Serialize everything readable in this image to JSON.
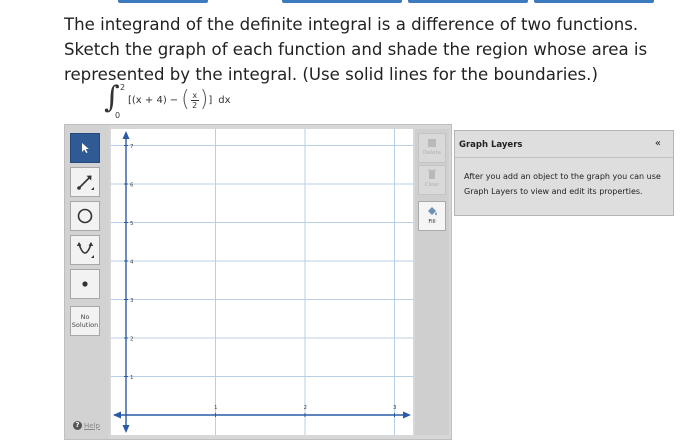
{
  "question": {
    "text": "The integrand of the definite integral is a difference of two functions. Sketch the graph of each function and shade the region whose area is represented by the integral. (Use solid lines for the boundaries.)"
  },
  "integral": {
    "upper": "2",
    "lower": "0",
    "bracket_open": "[",
    "term1": "(x + 4)",
    "minus": "−",
    "frac_num": "x",
    "frac_den": "2",
    "bracket_close": "]",
    "dx": "dx"
  },
  "toolbar": {
    "tools": [
      {
        "name": "select-tool",
        "icon": "arrow-pointer-icon",
        "active": true
      },
      {
        "name": "line-tool",
        "icon": "line-segment-icon",
        "active": false
      },
      {
        "name": "circle-tool",
        "icon": "circle-icon",
        "active": false
      },
      {
        "name": "parabola-tool",
        "icon": "parabola-icon",
        "active": false
      },
      {
        "name": "point-tool",
        "icon": "point-icon",
        "active": false
      }
    ],
    "no_solution_label": "No Solution",
    "help_label": "Help"
  },
  "graph": {
    "y_ticks": [
      "7",
      "6",
      "5",
      "4",
      "3",
      "2",
      "1"
    ],
    "x_ticks": [
      "1",
      "2",
      "3"
    ],
    "axis_color": "#2a5aa6",
    "grid_color": "#b8cfe6"
  },
  "right_toolbar": {
    "delete_label": "Delete",
    "clear_label": "Clear",
    "fill_label": "Fill"
  },
  "graph_layers": {
    "title": "Graph Layers",
    "collapse_symbol": "«",
    "body": "After you add an object to the graph you can use Graph Layers to view and edit its properties."
  }
}
